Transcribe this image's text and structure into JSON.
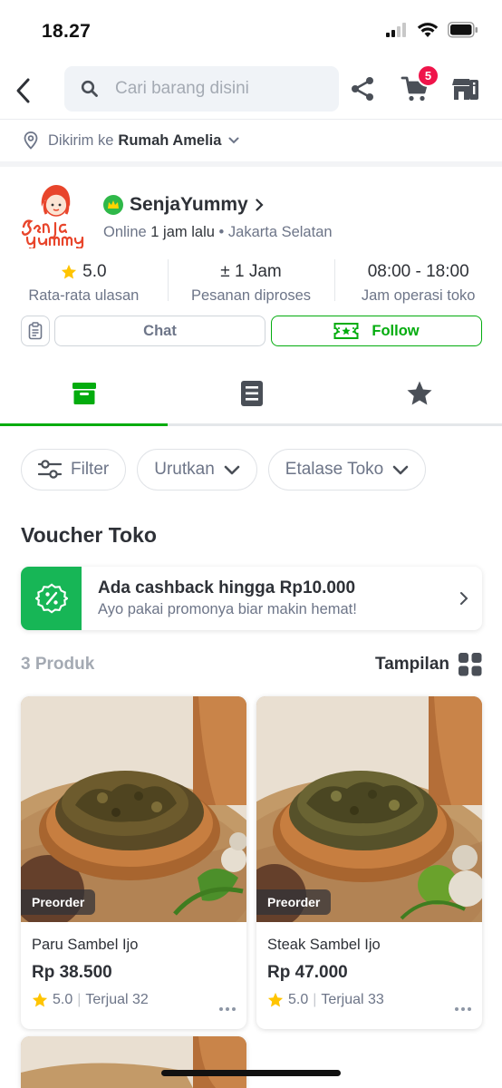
{
  "status_bar": {
    "time": "18.27"
  },
  "nav": {
    "search_placeholder": "Cari barang disini",
    "cart_count": "5"
  },
  "address": {
    "prefix": "Dikirim ke",
    "name": "Rumah Amelia"
  },
  "shop": {
    "name": "SenjaYummy",
    "online_prefix": "Online",
    "online_time": "1 jam lalu",
    "separator": "•",
    "location": "Jakarta Selatan",
    "stats": [
      {
        "value": "5.0",
        "label": "Rata-rata ulasan"
      },
      {
        "value": "± 1 Jam",
        "label": "Pesanan diproses"
      },
      {
        "value": "08:00 - 18:00",
        "label": "Jam operasi toko"
      }
    ],
    "chat_label": "Chat",
    "follow_label": "Follow"
  },
  "tabs": [
    {
      "icon": "store-icon",
      "active": true
    },
    {
      "icon": "catalog-icon",
      "active": false
    },
    {
      "icon": "star-icon",
      "active": false
    }
  ],
  "filters": {
    "filter_label": "Filter",
    "sort_label": "Urutkan",
    "showcase_label": "Etalase Toko"
  },
  "voucher": {
    "section_title": "Voucher Toko",
    "main": "Ada cashback hingga Rp10.000",
    "sub": "Ayo pakai promonya biar makin hemat!"
  },
  "products_bar": {
    "count": "3 Produk",
    "view_label": "Tampilan"
  },
  "products": [
    {
      "badge": "Preorder",
      "name": "Paru Sambel Ijo",
      "price": "Rp 38.500",
      "rating": "5.0",
      "sold": "Terjual 32"
    },
    {
      "badge": "Preorder",
      "name": "Steak Sambel Ijo",
      "price": "Rp 47.000",
      "rating": "5.0",
      "sold": "Terjual 33"
    }
  ],
  "colors": {
    "brand_green": "#03ac0e",
    "badge_red": "#ef144a",
    "rating_star": "#ffc400"
  }
}
